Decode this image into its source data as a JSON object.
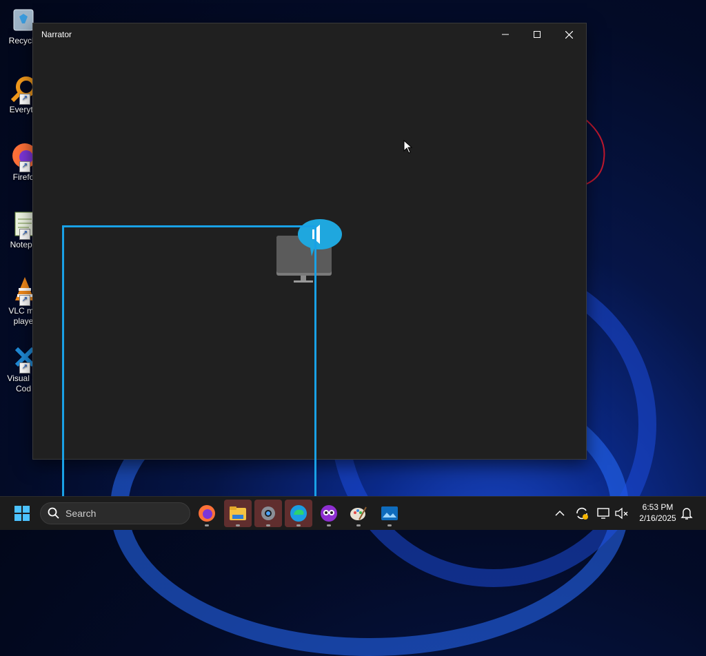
{
  "desktop": {
    "icons": [
      {
        "label": "Recycle",
        "icon": "recycle-bin-icon"
      },
      {
        "label": "Everyth",
        "icon": "everything-search-icon"
      },
      {
        "label": "Firefo",
        "icon": "firefox-icon"
      },
      {
        "label": "Notepa",
        "icon": "notepad-icon"
      },
      {
        "label": "VLC me\nplaye",
        "icon": "vlc-icon"
      },
      {
        "label": "Visual St\nCod",
        "icon": "vscode-icon"
      }
    ]
  },
  "window": {
    "title": "Narrator",
    "minimize_icon": "minimize-icon",
    "maximize_icon": "maximize-icon",
    "close_icon": "close-icon"
  },
  "narrator": {
    "icon": "narrator-icon"
  },
  "taskbar": {
    "start_icon": "windows-start-icon",
    "search": {
      "placeholder": "Search",
      "icon": "search-icon"
    },
    "apps": [
      {
        "name": "Firefox",
        "icon": "firefox-icon"
      },
      {
        "name": "File Explorer",
        "icon": "file-explorer-icon"
      },
      {
        "name": "Settings",
        "icon": "settings-icon"
      },
      {
        "name": "Microsoft Edge",
        "icon": "edge-icon"
      },
      {
        "name": "Copilot",
        "icon": "copilot-icon"
      },
      {
        "name": "Paint",
        "icon": "paint-icon"
      },
      {
        "name": "Photos",
        "icon": "photos-icon"
      }
    ],
    "tray": {
      "chevron_icon": "chevron-up-icon",
      "update_icon": "sync-update-icon",
      "network_icon": "network-icon",
      "volume_icon": "volume-muted-icon",
      "notification_icon": "bell-icon"
    },
    "time": "6:53 PM",
    "date": "2/16/2025"
  },
  "colors": {
    "accent": "#19a1e6",
    "window_bg": "#202020",
    "taskbar_bg": "#1c1c1c"
  }
}
